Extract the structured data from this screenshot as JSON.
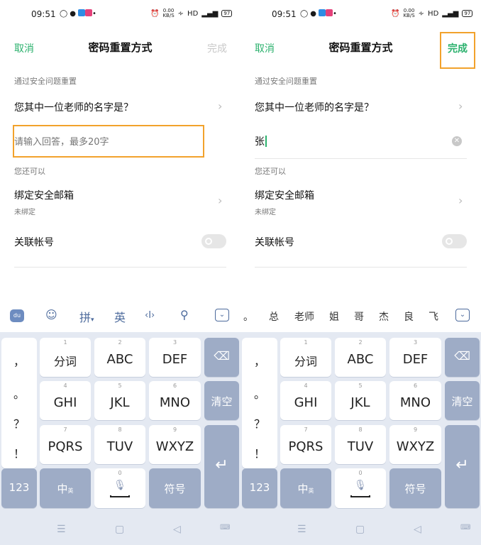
{
  "status": {
    "time": "09:51",
    "speed_value": "0.00",
    "speed_unit": "KB/S",
    "hd": "HD",
    "battery": "97"
  },
  "header": {
    "cancel": "取消",
    "title": "密码重置方式",
    "done": "完成"
  },
  "security": {
    "section_label": "通过安全问题重置",
    "question": "您其中一位老师的名字是？",
    "answer_placeholder": "请输入回答，最多20字",
    "typed_answer": "张"
  },
  "more": {
    "section_label": "您还可以",
    "bind_email": "绑定安全邮箱",
    "bind_email_status": "未绑定",
    "link_account": "关联帐号"
  },
  "toolbar": {
    "logo": "du",
    "pinyin": "拼",
    "english": "英",
    "cursor_tool": "‹I›",
    "candidates": [
      "。",
      "总",
      "老师",
      "姐",
      "哥",
      "杰",
      "良",
      "飞"
    ]
  },
  "keyboard": {
    "punctuation": [
      "，",
      "。",
      "？",
      "！"
    ],
    "keys": [
      {
        "num": "1",
        "label": "分词"
      },
      {
        "num": "2",
        "label": "ABC"
      },
      {
        "num": "3",
        "label": "DEF"
      },
      {
        "num": "4",
        "label": "GHI"
      },
      {
        "num": "5",
        "label": "JKL"
      },
      {
        "num": "6",
        "label": "MNO"
      },
      {
        "num": "7",
        "label": "PQRS"
      },
      {
        "num": "8",
        "label": "TUV"
      },
      {
        "num": "9",
        "label": "WXYZ"
      }
    ],
    "clear": "清空",
    "num_key": "123",
    "lang_key": "中",
    "lang_sub": "英",
    "space_num": "0",
    "symbol_key": "符号"
  },
  "colors": {
    "accent": "#2bb16d",
    "highlight": "#f2a22c",
    "keyboard_bg": "#e4e9f2",
    "dark_key": "#9eacc6"
  }
}
